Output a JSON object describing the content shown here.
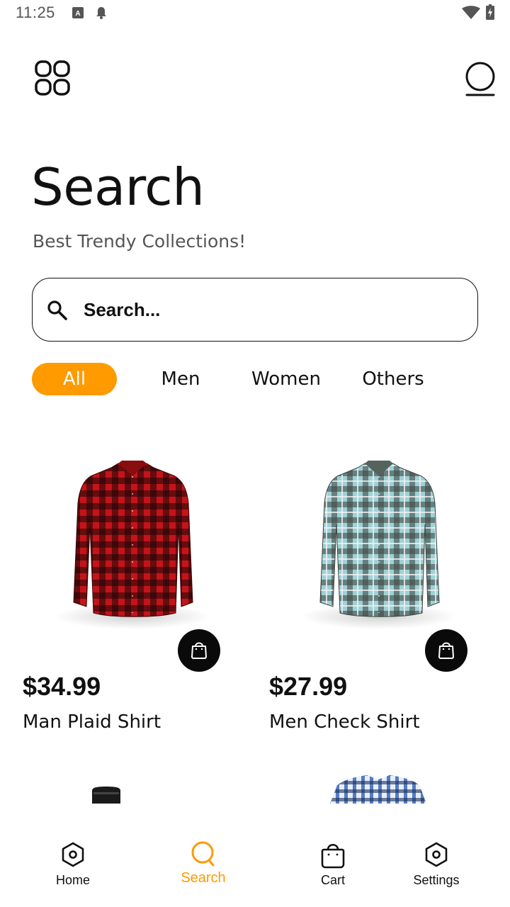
{
  "status_bar": {
    "time": "11:25",
    "icons": [
      "text-notification-icon",
      "bell-icon",
      "wifi-icon",
      "battery-charging-icon"
    ]
  },
  "header": {
    "menu_icon": "grid-menu-icon",
    "profile_icon": "profile-icon"
  },
  "page": {
    "title": "Search",
    "subtitle": "Best Trendy Collections!"
  },
  "search": {
    "placeholder": "Search...",
    "value": ""
  },
  "categories": [
    {
      "label": "All",
      "selected": true
    },
    {
      "label": "Men",
      "selected": false
    },
    {
      "label": "Women",
      "selected": false
    },
    {
      "label": "Others",
      "selected": false
    }
  ],
  "products": [
    {
      "price": "$34.99",
      "name": "Man Plaid Shirt",
      "image": "red-black-plaid-shirt",
      "action_icon": "shopping-bag-icon"
    },
    {
      "price": "$27.99",
      "name": "Men Check Shirt",
      "image": "teal-grey-check-shirt",
      "action_icon": "shopping-bag-icon"
    },
    {
      "image": "black-bottle-product"
    },
    {
      "image": "blue-check-shirt"
    }
  ],
  "bottom_nav": [
    {
      "label": "Home",
      "icon": "home-icon",
      "active": false
    },
    {
      "label": "Search",
      "icon": "search-icon",
      "active": true
    },
    {
      "label": "Cart",
      "icon": "bag-icon",
      "active": false
    },
    {
      "label": "Settings",
      "icon": "settings-icon",
      "active": false
    }
  ],
  "colors": {
    "accent": "#ff9a00",
    "text": "#111111",
    "muted": "#555555",
    "background": "#ffffff"
  }
}
